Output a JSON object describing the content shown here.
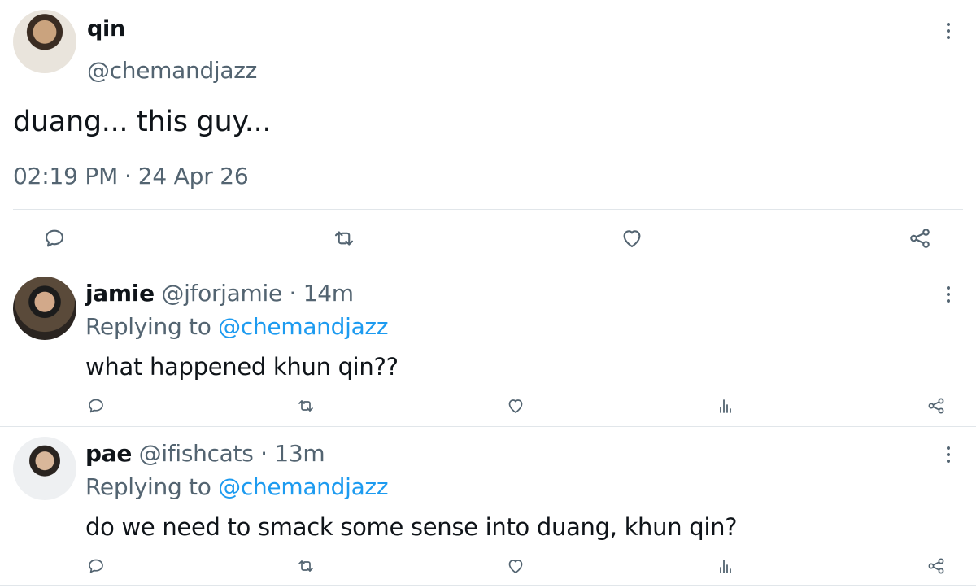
{
  "main_tweet": {
    "name": "qin",
    "handle": "@chemandjazz",
    "text": "duang... this guy...",
    "time": "02:19 PM",
    "separator": "·",
    "date": "24 Apr 26",
    "icons": [
      "comment-icon",
      "retweet-icon",
      "like-icon",
      "share-icon"
    ]
  },
  "replies": [
    {
      "name": "jamie",
      "handle": "@jforjamie",
      "separator": "·",
      "time": "14m",
      "replying_prefix": "Replying to",
      "replying_to": "@chemandjazz",
      "text": "what happened khun qin??"
    },
    {
      "name": "pae",
      "handle": "@ifishcats",
      "separator": "·",
      "time": "13m",
      "replying_prefix": "Replying to",
      "replying_to": "@chemandjazz",
      "text": "do we need to smack some sense into duang, khun qin?"
    }
  ],
  "colors": {
    "text": "#0f1419",
    "secondary": "#536471",
    "mention": "#1d9bf0",
    "divider": "#e1e6ea"
  }
}
